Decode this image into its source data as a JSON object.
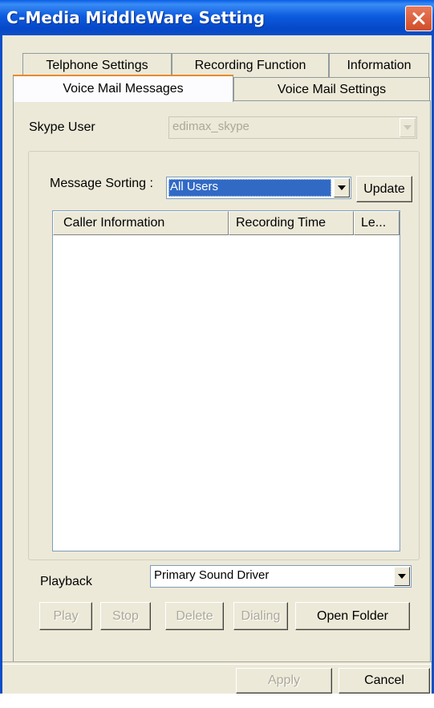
{
  "window": {
    "title": "C-Media MiddleWare Setting"
  },
  "tabs": {
    "row1": [
      "Telphone Settings",
      "Recording Function",
      "Information"
    ],
    "row2": [
      "Voice Mail Messages",
      "Voice Mail Settings"
    ],
    "active": "Voice Mail Messages"
  },
  "skype_user": {
    "label": "Skype User",
    "value": "edimax_skype"
  },
  "message_sorting": {
    "label": "Message Sorting :",
    "value": "All Users",
    "update_label": "Update"
  },
  "messages_table": {
    "columns": [
      "Caller Information",
      "Recording Time",
      "Le..."
    ],
    "rows": []
  },
  "playback": {
    "label": "Playback",
    "value": "Primary Sound Driver"
  },
  "actions": {
    "play": "Play",
    "stop": "Stop",
    "delete": "Delete",
    "dialing": "Dialing",
    "open_folder": "Open Folder"
  },
  "footer": {
    "apply": "Apply",
    "cancel": "Cancel"
  },
  "colors": {
    "titlebar": "#0a5ee6",
    "dialog_bg": "#ece9d8",
    "selection": "#316ac5",
    "close_button": "#d04d28"
  },
  "icons": {
    "close": "close-icon",
    "dropdown": "chevron-down-icon"
  }
}
